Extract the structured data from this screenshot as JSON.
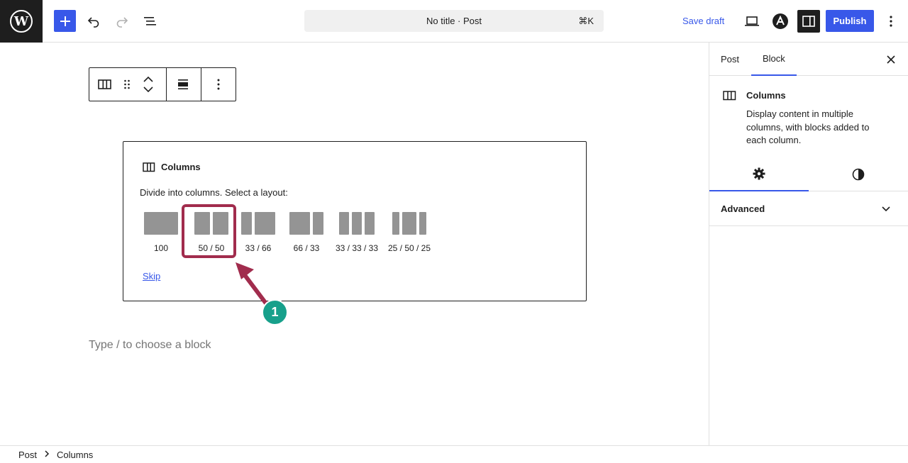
{
  "header": {
    "document_title": "No title · Post",
    "shortcut": "⌘K",
    "save_draft_label": "Save draft",
    "publish_label": "Publish"
  },
  "block_placeholder": {
    "title": "Columns",
    "instructions": "Divide into columns. Select a layout:",
    "variations": [
      {
        "label": "100"
      },
      {
        "label": "50 / 50"
      },
      {
        "label": "33 / 66"
      },
      {
        "label": "66 / 33"
      },
      {
        "label": "33 / 33 / 33"
      },
      {
        "label": "25 / 50 / 25"
      }
    ],
    "skip_label": "Skip"
  },
  "annotation": {
    "step_number": "1",
    "highlight_color": "#a12c4d",
    "badge_color": "#17a08b"
  },
  "canvas": {
    "appender_placeholder": "Type / to choose a block"
  },
  "sidebar": {
    "tabs": [
      {
        "label": "Post",
        "active": false
      },
      {
        "label": "Block",
        "active": true
      }
    ],
    "block_card": {
      "title": "Columns",
      "description": "Display content in multiple columns, with blocks added to each column."
    },
    "panel_title": "Advanced"
  },
  "breadcrumb": {
    "items": [
      "Post",
      "Columns"
    ]
  },
  "colors": {
    "accent": "#3858e9",
    "dark": "#1e1e1e",
    "placeholder_bar": "#949494"
  }
}
